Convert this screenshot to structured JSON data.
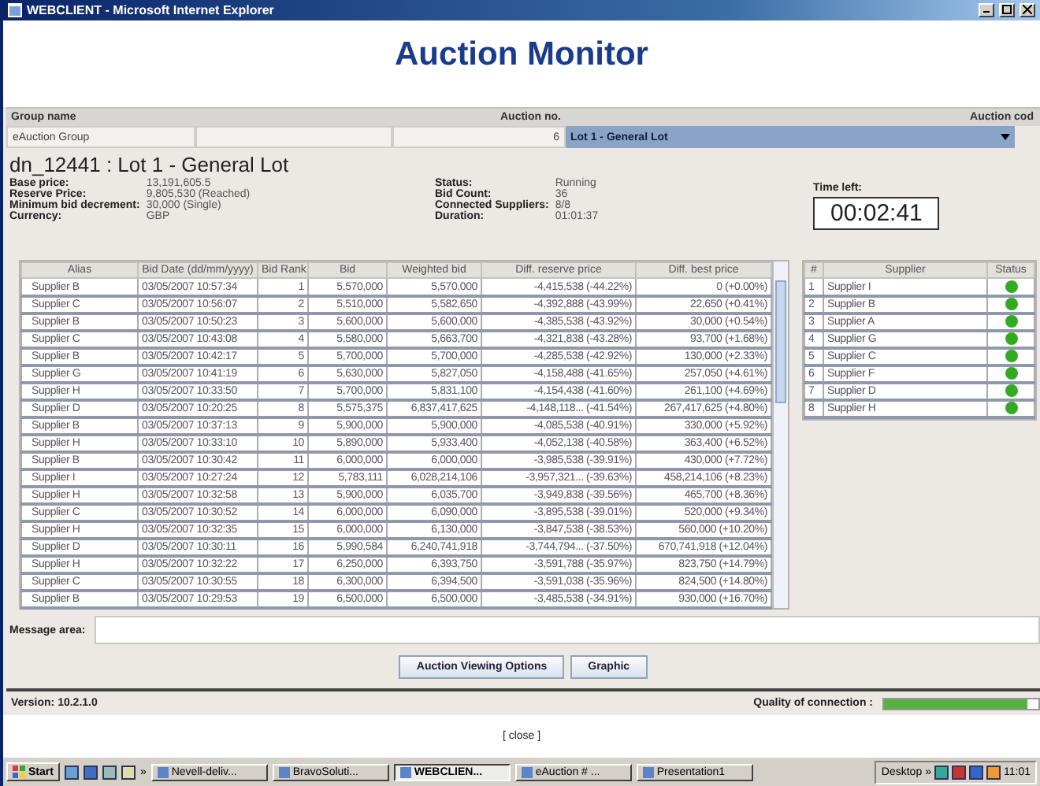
{
  "window": {
    "title": "WEBCLIENT - Microsoft Internet Explorer"
  },
  "page_title": "Auction Monitor",
  "group_name": {
    "label": "Group name",
    "value": "eAuction Group"
  },
  "auction_no": {
    "label": "Auction no.",
    "value": "6"
  },
  "auction_code": {
    "label": "Auction cod",
    "value": "Lot 1 - General Lot"
  },
  "lot": {
    "title": "dn_12441 : Lot 1 - General Lot",
    "details": [
      {
        "label": "Base price:",
        "value": "13,191,605.5"
      },
      {
        "label": "Reserve Price:",
        "value": "9,805,530 (Reached)"
      },
      {
        "label": "Minimum bid decrement:",
        "value": "30,000 (Single)"
      },
      {
        "label": "Currency:",
        "value": "GBP"
      }
    ],
    "status": [
      {
        "label": "Status:",
        "value": "Running"
      },
      {
        "label": "Bid Count:",
        "value": "36"
      },
      {
        "label": "Connected Suppliers:",
        "value": "8/8"
      },
      {
        "label": "Duration:",
        "value": "01:01:37"
      }
    ],
    "time_left": {
      "label": "Time left:",
      "value": "00:02:41"
    }
  },
  "bids": {
    "columns": [
      "Alias",
      "Bid Date (dd/mm/yyyy)",
      "Bid Rank",
      "Bid",
      "Weighted bid",
      "Diff. reserve price",
      "Diff. best price"
    ],
    "rows": [
      [
        "Supplier B",
        "03/05/2007 10:57:34",
        "1",
        "5,570,000",
        "5,570,000",
        "-4,415,538 (-44.22%)",
        "0 (+0.00%)"
      ],
      [
        "Supplier C",
        "03/05/2007 10:56:07",
        "2",
        "5,510,000",
        "5,582,650",
        "-4,392,888 (-43.99%)",
        "22,650 (+0.41%)"
      ],
      [
        "Supplier B",
        "03/05/2007 10:50:23",
        "3",
        "5,600,000",
        "5,600,000",
        "-4,385,538 (-43.92%)",
        "30,000 (+0.54%)"
      ],
      [
        "Supplier C",
        "03/05/2007 10:43:08",
        "4",
        "5,580,000",
        "5,663,700",
        "-4,321,838 (-43.28%)",
        "93,700 (+1.68%)"
      ],
      [
        "Supplier B",
        "03/05/2007 10:42:17",
        "5",
        "5,700,000",
        "5,700,000",
        "-4,285,538 (-42.92%)",
        "130,000 (+2.33%)"
      ],
      [
        "Supplier G",
        "03/05/2007 10:41:19",
        "6",
        "5,630,000",
        "5,827,050",
        "-4,158,488 (-41.65%)",
        "257,050 (+4.61%)"
      ],
      [
        "Supplier H",
        "03/05/2007 10:33:50",
        "7",
        "5,700,000",
        "5,831,100",
        "-4,154,438 (-41.60%)",
        "261,100 (+4.69%)"
      ],
      [
        "Supplier D",
        "03/05/2007 10:20:25",
        "8",
        "5,575,375",
        "6,837,417,625",
        "-4,148,118... (-41.54%)",
        "267,417,625 (+4.80%)"
      ],
      [
        "Supplier B",
        "03/05/2007 10:37:13",
        "9",
        "5,900,000",
        "5,900,000",
        "-4,085,538 (-40.91%)",
        "330,000 (+5.92%)"
      ],
      [
        "Supplier H",
        "03/05/2007 10:33:10",
        "10",
        "5,890,000",
        "5,933,400",
        "-4,052,138 (-40.58%)",
        "363,400 (+6.52%)"
      ],
      [
        "Supplier B",
        "03/05/2007 10:30:42",
        "11",
        "6,000,000",
        "6,000,000",
        "-3,985,538 (-39.91%)",
        "430,000 (+7.72%)"
      ],
      [
        "Supplier I",
        "03/05/2007 10:27:24",
        "12",
        "5,783,111",
        "6,028,214,106",
        "-3,957,321... (-39.63%)",
        "458,214,106 (+8.23%)"
      ],
      [
        "Supplier H",
        "03/05/2007 10:32:58",
        "13",
        "5,900,000",
        "6,035,700",
        "-3,949,838 (-39.56%)",
        "465,700 (+8.36%)"
      ],
      [
        "Supplier C",
        "03/05/2007 10:30:52",
        "14",
        "6,000,000",
        "6,090,000",
        "-3,895,538 (-39.01%)",
        "520,000 (+9.34%)"
      ],
      [
        "Supplier H",
        "03/05/2007 10:32:35",
        "15",
        "6,000,000",
        "6,130,000",
        "-3,847,538 (-38.53%)",
        "560,000 (+10.20%)"
      ],
      [
        "Supplier D",
        "03/05/2007 10:30:11",
        "16",
        "5,990,584",
        "6,240,741,918",
        "-3,744,794... (-37.50%)",
        "670,741,918 (+12.04%)"
      ],
      [
        "Supplier H",
        "03/05/2007 10:32:22",
        "17",
        "6,250,000",
        "6,393,750",
        "-3,591,788 (-35.97%)",
        "823,750 (+14.79%)"
      ],
      [
        "Supplier C",
        "03/05/2007 10:30:55",
        "18",
        "6,300,000",
        "6,394,500",
        "-3,591,038 (-35.96%)",
        "824,500 (+14.80%)"
      ],
      [
        "Supplier B",
        "03/05/2007 10:29:53",
        "19",
        "6,500,000",
        "6,500,000",
        "-3,485,538 (-34.91%)",
        "930,000 (+16.70%)"
      ]
    ]
  },
  "suppliers": {
    "columns": [
      "#",
      "Supplier",
      "Status"
    ],
    "rows": [
      {
        "number": "1",
        "name": "Supplier I",
        "color": "#33aa22"
      },
      {
        "number": "2",
        "name": "Supplier B",
        "color": "#33aa22"
      },
      {
        "number": "3",
        "name": "Supplier A",
        "color": "#33aa22"
      },
      {
        "number": "4",
        "name": "Supplier G",
        "color": "#33aa22"
      },
      {
        "number": "5",
        "name": "Supplier C",
        "color": "#33aa22"
      },
      {
        "number": "6",
        "name": "Supplier F",
        "color": "#33aa22"
      },
      {
        "number": "7",
        "name": "Supplier D",
        "color": "#33aa22"
      },
      {
        "number": "8",
        "name": "Supplier H",
        "color": "#33aa22"
      }
    ]
  },
  "message_area": {
    "label": "Message area:"
  },
  "buttons": [
    "Auction Viewing Options",
    "Graphic"
  ],
  "status_bar": {
    "version": "Version: 10.2.1.0",
    "quality_label": "Quality of connection :",
    "level": 0.93
  },
  "close_link": "[ close ]",
  "taskbar": {
    "start": "Start",
    "quick_more": "»",
    "items": [
      {
        "label": "Nevell-deliv...",
        "selected": false
      },
      {
        "label": "BravoSoluti...",
        "selected": false
      },
      {
        "label": "WEBCLIEN...",
        "selected": true
      },
      {
        "label": "eAuction # ...",
        "selected": false
      },
      {
        "label": "Presentation1",
        "selected": false
      }
    ],
    "desktop": "Desktop",
    "tray_more": "»",
    "clock": "11:01"
  }
}
